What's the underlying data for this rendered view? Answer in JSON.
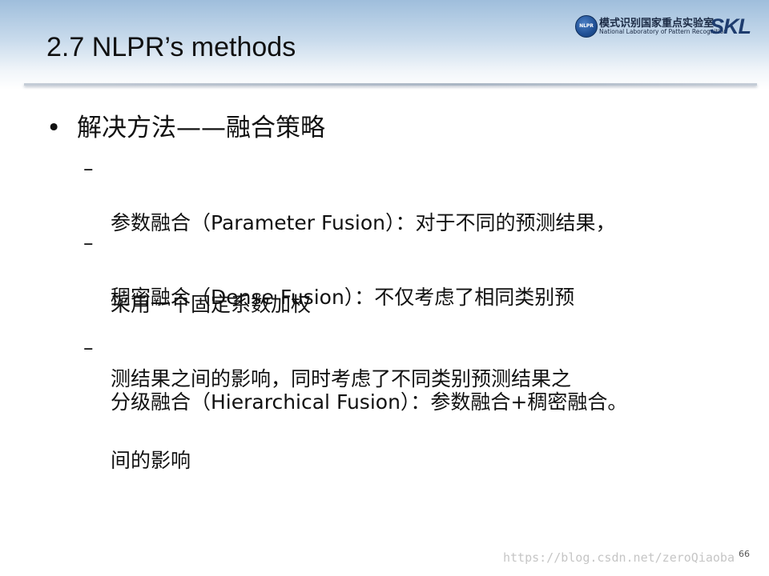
{
  "header": {
    "title": "2.7 NLPR’s methods",
    "logo": {
      "emblem_icon": "nlpr-emblem-icon",
      "cn_name": "模式识别国家重点实验室",
      "en_name": "National Laboratory of Pattern Recognition",
      "mark": "SKL"
    }
  },
  "content": {
    "heading": {
      "bullet": "•",
      "text": "解决方法——融合策略"
    },
    "items": [
      {
        "dash": "–",
        "lines": [
          "参数融合（Parameter Fusion）：对于不同的预测结果，",
          "采用一个固定系数加权"
        ]
      },
      {
        "dash": "–",
        "lines": [
          "稠密融合（Dense Fusion）：不仅考虑了相同类别预",
          "测结果之间的影响，同时考虑了不同类别预测结果之",
          "间的影响"
        ]
      },
      {
        "dash": "–",
        "lines": [
          "分级融合（Hierarchical Fusion）：参数融合+稠密融合。"
        ]
      }
    ]
  },
  "footer": {
    "page_number": "66",
    "watermark": "https://blog.csdn.net/zeroQiaoba"
  }
}
